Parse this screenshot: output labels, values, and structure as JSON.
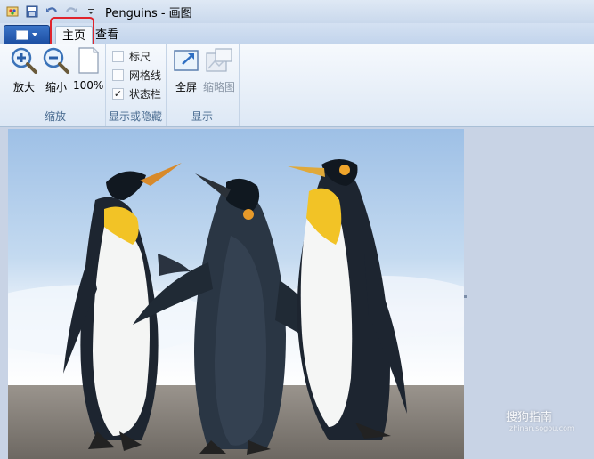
{
  "titlebar": {
    "title": "Penguins - 画图",
    "quick_access": [
      "paint-app-icon",
      "save-icon",
      "undo-icon",
      "redo-icon",
      "customize-caret-icon"
    ]
  },
  "tabs": {
    "home": "主页",
    "view": "查看"
  },
  "zoom_group": {
    "zoom_in": "放大",
    "zoom_out": "缩小",
    "actual_size": "100%",
    "label": "缩放"
  },
  "show_hide_group": {
    "ruler": {
      "label": "标尺",
      "checked": false
    },
    "gridlines": {
      "label": "网格线",
      "checked": false
    },
    "statusbar": {
      "label": "状态栏",
      "checked": true
    },
    "label": "显示或隐藏"
  },
  "display_group": {
    "fullscreen": "全屏",
    "thumbnail": "缩略图",
    "label": "显示"
  },
  "watermark": {
    "text": "搜狗指南",
    "url": "zhinan.sogou.com"
  },
  "colors": {
    "highlight": "#e0242d",
    "ribbon_bg": "#eef3fa",
    "canvas_bg": "#c8d3e5"
  }
}
